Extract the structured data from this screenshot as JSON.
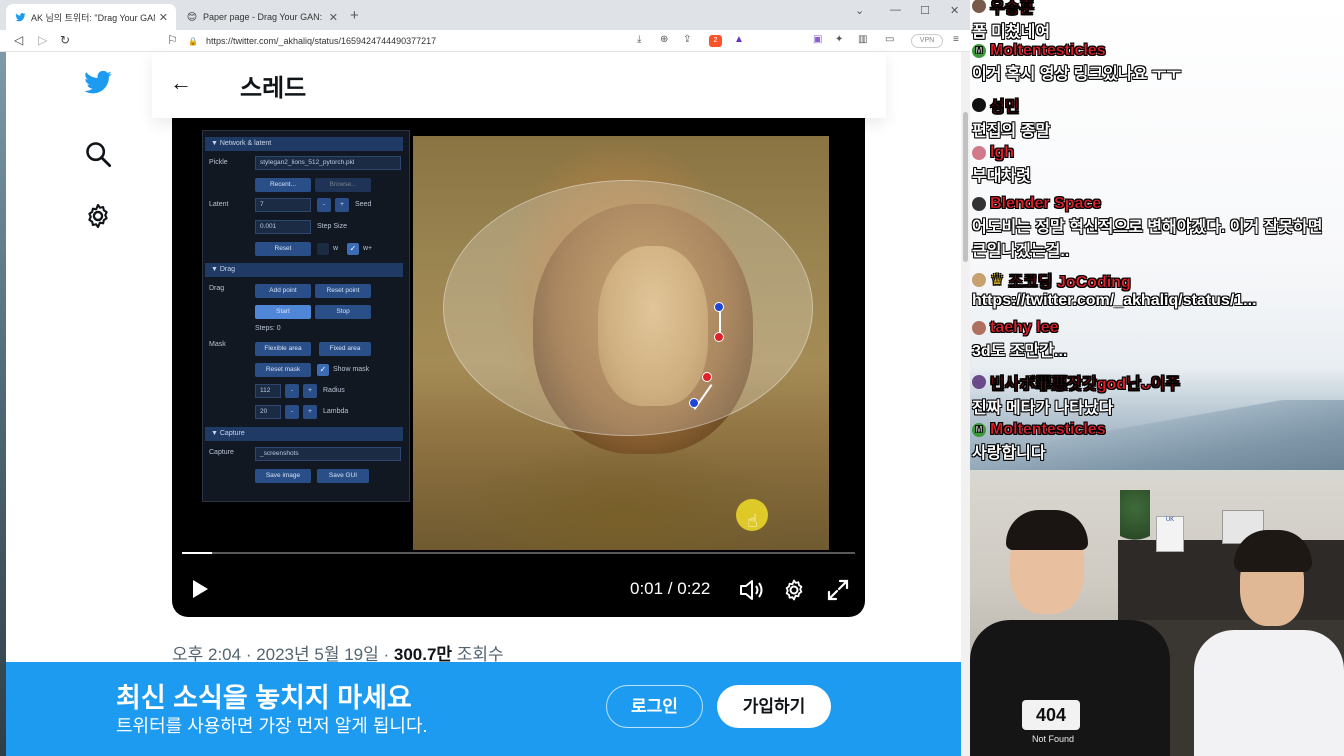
{
  "browser": {
    "tabs": [
      {
        "title": "AK 님의 트위터: \"Drag Your GAN:",
        "favicon": "twitter-icon",
        "active": true
      },
      {
        "title": "Paper page - Drag Your GAN: Interac",
        "favicon": "hf-icon",
        "active": false
      }
    ],
    "url": "https://twitter.com/_akhaliq/status/1659424744490377217",
    "vpn_label": "VPN"
  },
  "twitter": {
    "header_title": "스레드",
    "video": {
      "time": "0:01 / 0:22",
      "progress": 0.045,
      "gui": {
        "sections": [
          "Network & latent",
          "Drag",
          "Capture"
        ],
        "pickle_label": "Pickle",
        "pickle_value": "stylegan2_lions_512_pytorch.pkl",
        "recent_btn": "Recent...",
        "browse_btn": "Browse...",
        "latent_label": "Latent",
        "seed_value": "7",
        "seed_label": "Seed",
        "step_value": "0.001",
        "step_label": "Step Size",
        "reset_btn": "Reset",
        "w_label": "w",
        "wplus_label": "w+",
        "drag_label": "Drag",
        "add_point_btn": "Add point",
        "reset_point_btn": "Reset point",
        "start_btn": "Start",
        "stop_btn": "Stop",
        "steps_label": "Steps: 0",
        "mask_label": "Mask",
        "flexible_btn": "Flexible area",
        "fixed_btn": "Fixed area",
        "reset_mask_btn": "Reset mask",
        "show_mask_label": "Show mask",
        "radius_value": "112",
        "radius_label": "Radius",
        "lambda_value": "20",
        "lambda_label": "Lambda",
        "capture_label": "Capture",
        "capture_value": "_screenshots",
        "save_image_btn": "Save image",
        "save_gui_btn": "Save GUI"
      }
    },
    "meta": {
      "time_date": "오후 2:04 · 2023년 5월 19일 · ",
      "views": "300.7만",
      "views_label": " 조회수"
    },
    "banner": {
      "title": "최신 소식을 놓치지 마세요",
      "subtitle": "트위터를 사용하면 가장 먼저 알게 됩니다.",
      "login": "로그인",
      "signup": "가입하기"
    }
  },
  "chat": [
    {
      "user": "우승훈",
      "message": "폼 미쳤네여",
      "avatar_color": "#7a5a4a"
    },
    {
      "user": "Moltentesticles",
      "message": "이거 혹시 영상 링크있나요 ㅜㅜ",
      "avatar_color": "#3a9a3a",
      "avatar_text": "M"
    },
    {
      "user": "성민",
      "message": "편집의 종말",
      "avatar_color": "#111111"
    },
    {
      "user": "lgh",
      "message": "부대차렷",
      "avatar_color": "#d07a8a"
    },
    {
      "user": "Blender Space",
      "message": "어도비는 정말 혁신적으로 변해야겠다. 이거 잘못하면",
      "message2": "큰일나겠는걸..",
      "avatar_color": "#333333"
    },
    {
      "user": "조코딩 JoCoding",
      "message": "https://twitter.com/_akhaliq/status/1...",
      "avatar_color": "#c9a070"
    },
    {
      "user": "taehy lee",
      "message": "3d도 조만간...",
      "avatar_color": "#b07060"
    },
    {
      "user": "빈사ボ罪悪잣갓god난ᴗ이주",
      "message": "진짜 메타가 나타났다",
      "avatar_color": "#6a4a8a"
    },
    {
      "user": "Moltentesticles",
      "message": "사랑합니다",
      "avatar_color": "#3a9a3a",
      "avatar_text": "M"
    }
  ],
  "webcam": {
    "shirt_text": "404",
    "shirt_sub": "Not Found",
    "frame_text": "UK"
  }
}
